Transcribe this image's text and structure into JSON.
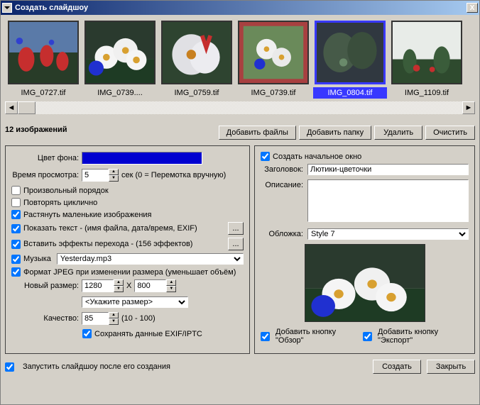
{
  "window": {
    "title": "Создать слайдшоу",
    "close_label": "X"
  },
  "thumbs": {
    "items": [
      {
        "file": "IMG_0727.tif",
        "selected": false
      },
      {
        "file": "IMG_0739....",
        "selected": false
      },
      {
        "file": "IMG_0759.tif",
        "selected": false
      },
      {
        "file": "IMG_0739.tif",
        "selected": false
      },
      {
        "file": "IMG_0804.tif",
        "selected": true
      },
      {
        "file": "IMG_1109.tif",
        "selected": false
      }
    ]
  },
  "count_label": "12 изображений",
  "buttons": {
    "add_files": "Добавить файлы",
    "add_folder": "Добавить папку",
    "delete": "Удалить",
    "clear": "Очистить",
    "more1": "...",
    "more2": "...",
    "create": "Создать",
    "close": "Закрыть"
  },
  "left": {
    "bg_color_label": "Цвет фона:",
    "bg_color": "#0000d0",
    "view_time_label": "Время просмотра:",
    "view_time": "5",
    "view_time_hint": "сек (0 = Перемотка вручную)",
    "random_label": "Произвольный порядок",
    "random_checked": false,
    "loop_label": "Повторять циклично",
    "loop_checked": false,
    "stretch_label": "Растянуть маленькие изображения",
    "stretch_checked": true,
    "showtext_label": "Показать текст - (имя файла, дата/время, EXIF)",
    "showtext_checked": true,
    "effects_label": "Вставить эффекты перехода - (156 эффектов)",
    "effects_checked": true,
    "music_label": "Музыка",
    "music_checked": true,
    "music_file": "Yesterday.mp3",
    "jpeg_label": "Формат JPEG при изменении размера (уменьшает объём)",
    "jpeg_checked": true,
    "newsize_label": "Новый размер:",
    "width": "1280",
    "x": "X",
    "height": "800",
    "size_preset": "<Укажите размер>",
    "quality_label": "Качество:",
    "quality": "85",
    "quality_hint": "(10 - 100)",
    "keep_exif_label": "Сохранять данные EXIF/IPTC",
    "keep_exif_checked": true
  },
  "right": {
    "create_start_label": "Создать начальное окно",
    "create_start_checked": true,
    "headline_label": "Заголовок:",
    "headline_value": "Лютики-цветочки",
    "desc_label": "Описание:",
    "desc_value": "",
    "cover_label": "Обложка:",
    "cover_style": "Style 7",
    "add_browse_label": "Добавить кнопку \"Обзор\"",
    "add_browse_checked": true,
    "add_export_label": "Добавить кнопку \"Экспорт\"",
    "add_export_checked": true
  },
  "footer": {
    "run_after_label": "Запустить слайдшоу после его создания",
    "run_after_checked": true
  }
}
